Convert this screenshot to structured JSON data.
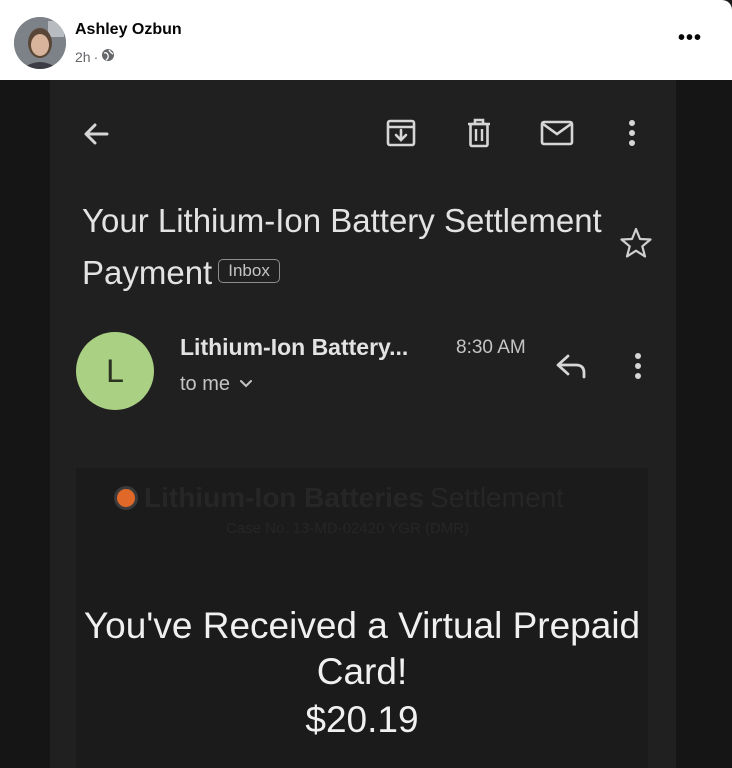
{
  "post": {
    "author": "Ashley Ozbun",
    "time": "2h",
    "separator": "·",
    "more": "•••"
  },
  "email": {
    "subject": "Your Lithium-Ion Battery Settlement Payment",
    "label": "Inbox",
    "sender_initial": "L",
    "sender_name": "Lithium-Ion Battery...",
    "time": "8:30 AM",
    "recipient": "to me"
  },
  "body": {
    "brand_bold": "Lithium-Ion Batteries",
    "brand_light": "Settlement",
    "case_no": "Case No. 13-MD-02420 YGR (DMR)",
    "headline": "You've Received a Virtual Prepaid Card!",
    "amount": "$20.19"
  },
  "colors": {
    "sender_avatar": "#aad083",
    "dark_background": "#202020",
    "text": "#e3e3e3"
  },
  "icons": [
    "back-arrow-icon",
    "archive-icon",
    "delete-icon",
    "mail-icon",
    "more-vert-icon",
    "star-icon",
    "reply-icon",
    "globe-icon",
    "chevron-down-icon"
  ]
}
